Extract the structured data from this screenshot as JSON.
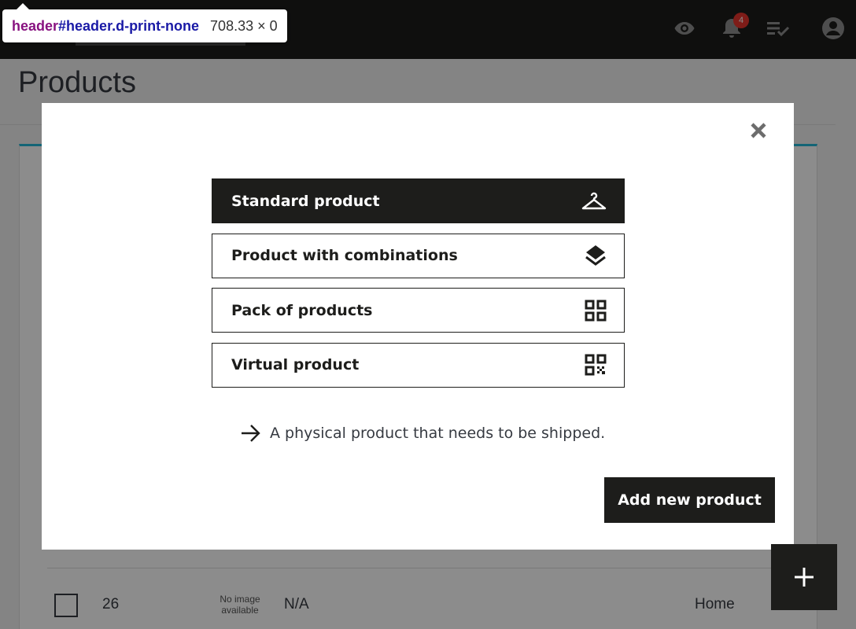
{
  "inspector_tooltip": {
    "tag": "header",
    "selector": "#header.d-print-none",
    "size": "708.33 × 0"
  },
  "header": {
    "notification_count": "4",
    "icons": [
      "eye-icon",
      "bell-icon",
      "checklist-icon",
      "account-icon"
    ]
  },
  "page": {
    "title": "Products"
  },
  "table_row": {
    "checkbox": "",
    "id": "26",
    "image_placeholder": "No image available",
    "reference": "N/A",
    "category": "Home"
  },
  "modal": {
    "options": [
      {
        "label": "Standard product",
        "icon": "hanger-icon",
        "selected": true
      },
      {
        "label": "Product with combinations",
        "icon": "layers-icon",
        "selected": false
      },
      {
        "label": "Pack of products",
        "icon": "grid-icon",
        "selected": false
      },
      {
        "label": "Virtual product",
        "icon": "qr-code-icon",
        "selected": false
      }
    ],
    "description": "A physical product that needs to be shipped.",
    "submit_label": "Add new product"
  },
  "fab": {
    "icon": "plus-icon"
  },
  "colors": {
    "dark": "#1d1d1b",
    "accent": "#25b9d7",
    "badge": "#e5342d"
  }
}
